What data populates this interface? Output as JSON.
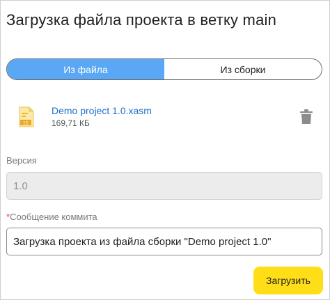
{
  "dialog": {
    "title": "Загрузка файла проекта в ветку main"
  },
  "tabs": [
    {
      "label": "Из файла",
      "active": true
    },
    {
      "label": "Из сборки",
      "active": false
    }
  ],
  "file": {
    "name": "Demo project 1.0.xasm",
    "size": "169,71 КБ",
    "icon": "xasm-file-icon",
    "badge": "1С",
    "action_icon": "trash-icon"
  },
  "version": {
    "label": "Версия",
    "value": "1.0",
    "disabled": true
  },
  "commit": {
    "required_mark": "*",
    "label": "Сообщение коммита",
    "value": "Загрузка проекта из файла сборки \"Demo project 1.0\""
  },
  "actions": {
    "upload_label": "Загрузить"
  },
  "colors": {
    "accent": "#5aa7f5",
    "primary_button": "#ffde17",
    "link": "#1f6fcc",
    "required": "#e53935"
  }
}
